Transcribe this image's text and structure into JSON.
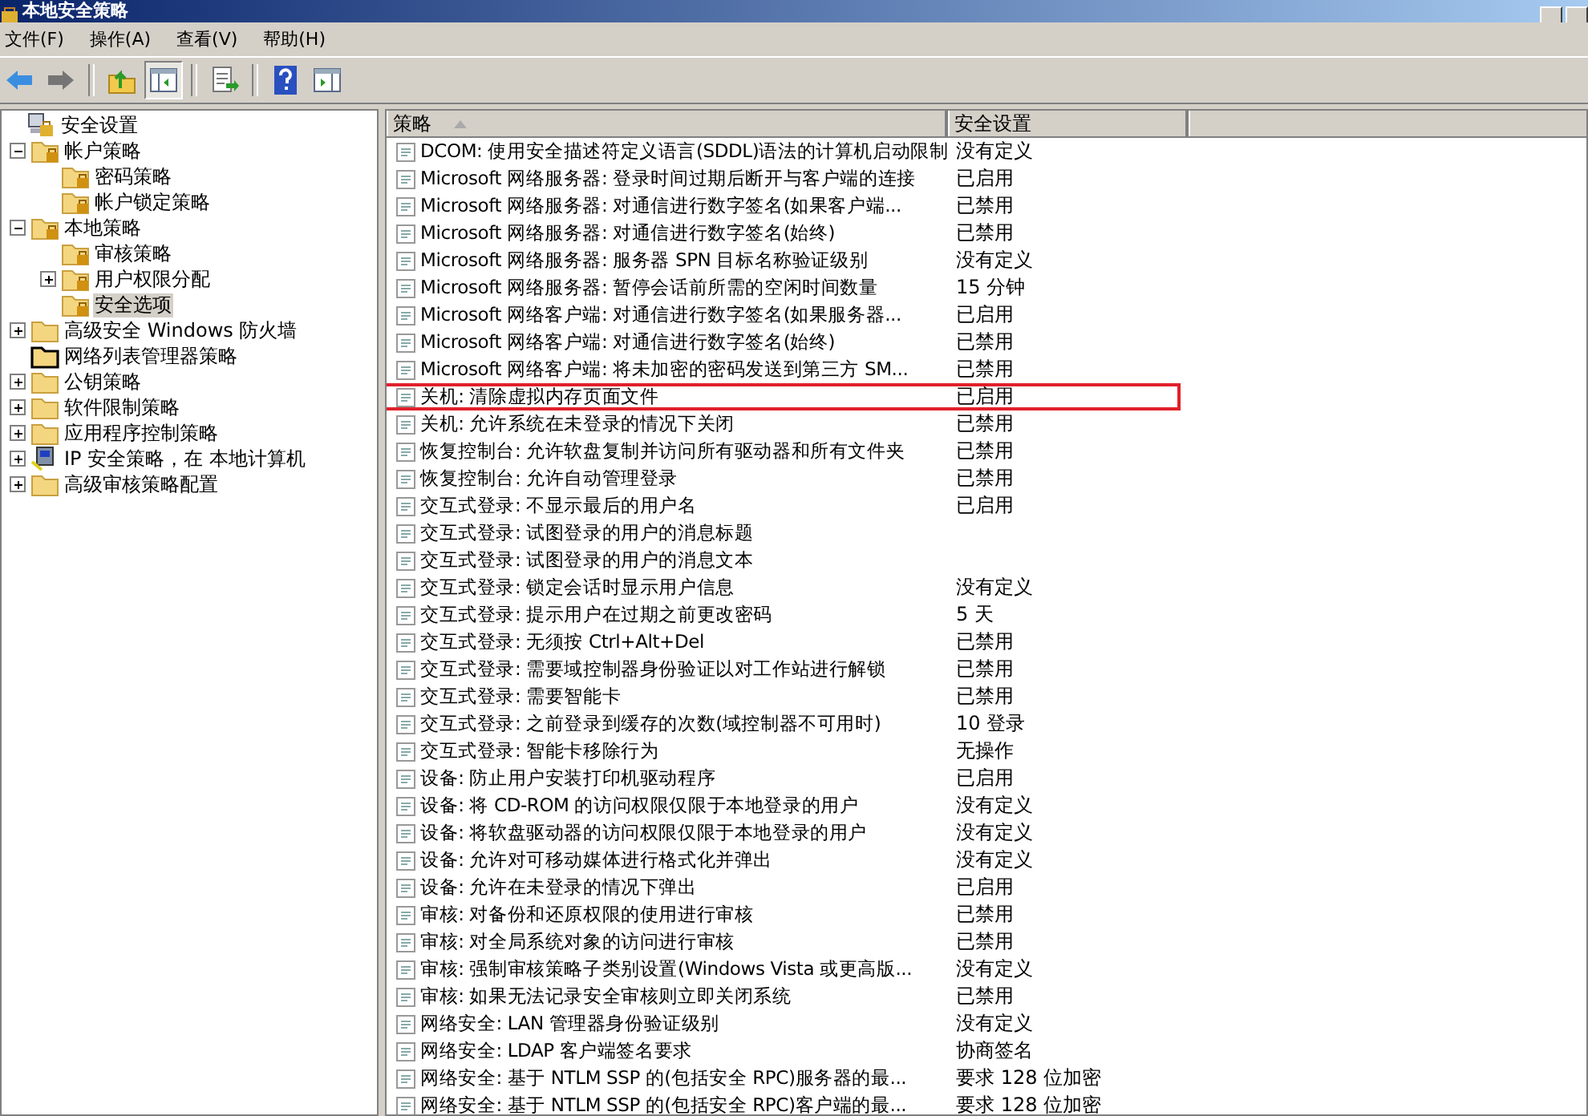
{
  "window": {
    "title": "本地安全策略"
  },
  "menu": [
    "文件(F)",
    "操作(A)",
    "查看(V)",
    "帮助(H)"
  ],
  "toolbar": [
    {
      "kind": "back",
      "disabled": false,
      "pressed": false
    },
    {
      "kind": "forward",
      "disabled": true,
      "pressed": false
    },
    {
      "kind": "up",
      "disabled": false,
      "pressed": false
    },
    {
      "kind": "tree",
      "disabled": false,
      "pressed": true
    },
    {
      "kind": "export",
      "disabled": false,
      "pressed": false
    },
    {
      "kind": "help",
      "disabled": false,
      "pressed": false
    },
    {
      "kind": "pane",
      "disabled": false,
      "pressed": false
    }
  ],
  "tree": [
    {
      "label": "安全设置",
      "kind": "root",
      "selected": false,
      "children": [
        {
          "label": "帐户策略",
          "kind": "locked",
          "expanded": true,
          "selected": false,
          "children": [
            {
              "label": "密码策略",
              "kind": "locked",
              "selected": false
            },
            {
              "label": "帐户锁定策略",
              "kind": "locked",
              "selected": false
            }
          ]
        },
        {
          "label": "本地策略",
          "kind": "locked",
          "expanded": true,
          "selected": false,
          "children": [
            {
              "label": "审核策略",
              "kind": "locked",
              "selected": false
            },
            {
              "label": "用户权限分配",
              "kind": "locked",
              "expanded": false,
              "selected": false
            },
            {
              "label": "安全选项",
              "kind": "locked",
              "selected": true
            }
          ]
        },
        {
          "label": "高级安全 Windows 防火墙",
          "kind": "folder",
          "expanded": false,
          "selected": false
        },
        {
          "label": "网络列表管理器策略",
          "kind": "framed",
          "selected": false
        },
        {
          "label": "公钥策略",
          "kind": "folder",
          "expanded": false,
          "selected": false
        },
        {
          "label": "软件限制策略",
          "kind": "folder",
          "expanded": false,
          "selected": false
        },
        {
          "label": "应用程序控制策略",
          "kind": "folder",
          "expanded": false,
          "selected": false
        },
        {
          "label": "IP 安全策略，在 本地计算机",
          "kind": "ip",
          "expanded": false,
          "selected": false
        },
        {
          "label": "高级审核策略配置",
          "kind": "folder",
          "expanded": false,
          "selected": false
        }
      ]
    }
  ],
  "table": {
    "columns": [
      "策略",
      "安全设置"
    ],
    "rows": [
      {
        "policy": "DCOM: 使用安全描述符定义语言(SDDL)语法的计算机启动限制",
        "setting": "没有定义",
        "highlighted": false
      },
      {
        "policy": "Microsoft 网络服务器: 登录时间过期后断开与客户端的连接",
        "setting": "已启用",
        "highlighted": false
      },
      {
        "policy": "Microsoft 网络服务器: 对通信进行数字签名(如果客户端...",
        "setting": "已禁用",
        "highlighted": false
      },
      {
        "policy": "Microsoft 网络服务器: 对通信进行数字签名(始终)",
        "setting": "已禁用",
        "highlighted": false
      },
      {
        "policy": "Microsoft 网络服务器: 服务器 SPN 目标名称验证级别",
        "setting": "没有定义",
        "highlighted": false
      },
      {
        "policy": "Microsoft 网络服务器: 暂停会话前所需的空闲时间数量",
        "setting": "15 分钟",
        "highlighted": false
      },
      {
        "policy": "Microsoft 网络客户端: 对通信进行数字签名(如果服务器...",
        "setting": "已启用",
        "highlighted": false
      },
      {
        "policy": "Microsoft 网络客户端: 对通信进行数字签名(始终)",
        "setting": "已禁用",
        "highlighted": false
      },
      {
        "policy": "Microsoft 网络客户端: 将未加密的密码发送到第三方 SM...",
        "setting": "已禁用",
        "highlighted": false
      },
      {
        "policy": "关机: 清除虚拟内存页面文件",
        "setting": "已启用",
        "highlighted": true
      },
      {
        "policy": "关机: 允许系统在未登录的情况下关闭",
        "setting": "已禁用",
        "highlighted": false
      },
      {
        "policy": "恢复控制台: 允许软盘复制并访问所有驱动器和所有文件夹",
        "setting": "已禁用",
        "highlighted": false
      },
      {
        "policy": "恢复控制台: 允许自动管理登录",
        "setting": "已禁用",
        "highlighted": false
      },
      {
        "policy": "交互式登录: 不显示最后的用户名",
        "setting": "已启用",
        "highlighted": false
      },
      {
        "policy": "交互式登录: 试图登录的用户的消息标题",
        "highlighted": false
      },
      {
        "policy": "交互式登录: 试图登录的用户的消息文本",
        "highlighted": false
      },
      {
        "policy": "交互式登录: 锁定会话时显示用户信息",
        "setting": "没有定义",
        "highlighted": false
      },
      {
        "policy": "交互式登录: 提示用户在过期之前更改密码",
        "setting": "5 天",
        "highlighted": false
      },
      {
        "policy": "交互式登录: 无须按 Ctrl+Alt+Del",
        "setting": "已禁用",
        "highlighted": false
      },
      {
        "policy": "交互式登录: 需要域控制器身份验证以对工作站进行解锁",
        "setting": "已禁用",
        "highlighted": false
      },
      {
        "policy": "交互式登录: 需要智能卡",
        "setting": "已禁用",
        "highlighted": false
      },
      {
        "policy": "交互式登录: 之前登录到缓存的次数(域控制器不可用时)",
        "setting": "10 登录",
        "highlighted": false
      },
      {
        "policy": "交互式登录: 智能卡移除行为",
        "setting": "无操作",
        "highlighted": false
      },
      {
        "policy": "设备: 防止用户安装打印机驱动程序",
        "setting": "已启用",
        "highlighted": false
      },
      {
        "policy": "设备: 将 CD-ROM 的访问权限仅限于本地登录的用户",
        "setting": "没有定义",
        "highlighted": false
      },
      {
        "policy": "设备: 将软盘驱动器的访问权限仅限于本地登录的用户",
        "setting": "没有定义",
        "highlighted": false
      },
      {
        "policy": "设备: 允许对可移动媒体进行格式化并弹出",
        "setting": "没有定义",
        "highlighted": false
      },
      {
        "policy": "设备: 允许在未登录的情况下弹出",
        "setting": "已启用",
        "highlighted": false
      },
      {
        "policy": "审核: 对备份和还原权限的使用进行审核",
        "setting": "已禁用",
        "highlighted": false
      },
      {
        "policy": "审核: 对全局系统对象的访问进行审核",
        "setting": "已禁用",
        "highlighted": false
      },
      {
        "policy": "审核: 强制审核策略子类别设置(Windows Vista 或更高版...",
        "setting": "没有定义",
        "highlighted": false
      },
      {
        "policy": "审核: 如果无法记录安全审核则立即关闭系统",
        "setting": "已禁用",
        "highlighted": false
      },
      {
        "policy": "网络安全: LAN 管理器身份验证级别",
        "setting": "没有定义",
        "highlighted": false
      },
      {
        "policy": "网络安全: LDAP 客户端签名要求",
        "setting": "协商签名",
        "highlighted": false
      },
      {
        "policy": "网络安全: 基于 NTLM SSP 的(包括安全 RPC)服务器的最...",
        "setting": "要求 128 位加密",
        "highlighted": false
      },
      {
        "policy": "网络安全: 基于 NTLM SSP 的(包括安全 RPC)客户端的最...",
        "setting": "要求 128 位加密",
        "highlighted": false
      }
    ]
  }
}
